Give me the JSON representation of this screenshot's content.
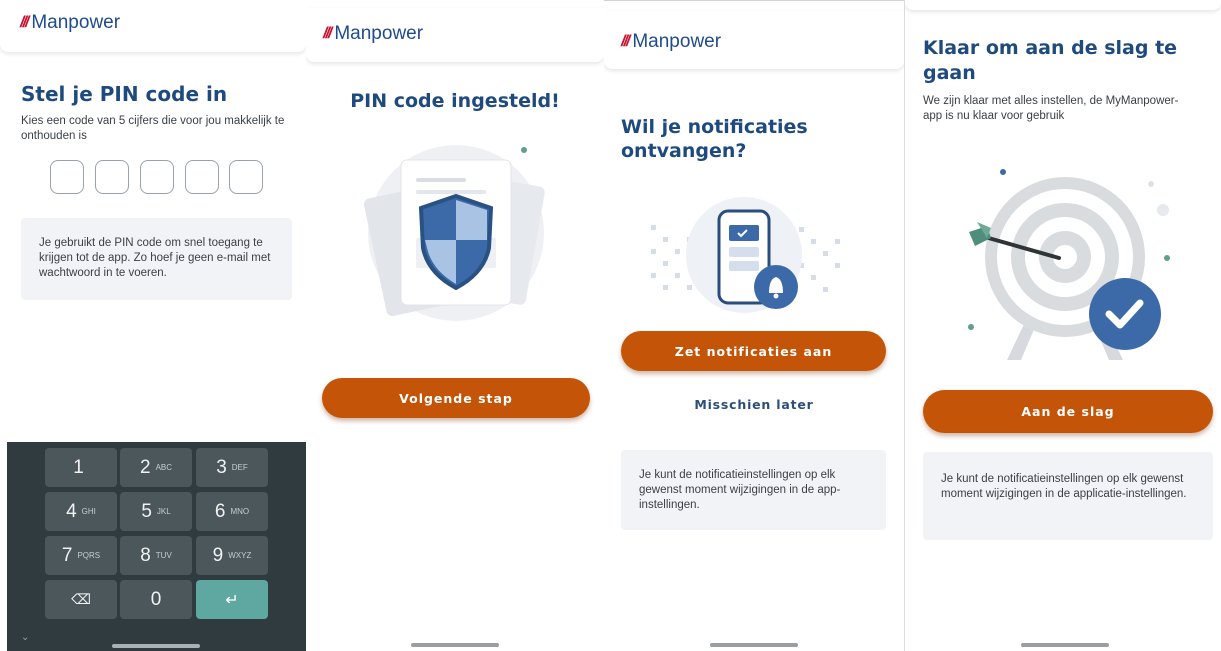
{
  "brand": {
    "mark": "///",
    "name": "Manpower"
  },
  "screen1": {
    "title": "Stel je PIN code in",
    "subtitle": "Kies een code van 5 cijfers die voor jou makkelijk te onthouden is",
    "info": "Je gebruikt de PIN code om snel toegang te krijgen tot de app. Zo hoef je geen e-mail met wachtwoord in te voeren.",
    "keypad": {
      "keys": [
        {
          "num": "1",
          "sub": ""
        },
        {
          "num": "2",
          "sub": "ABC"
        },
        {
          "num": "3",
          "sub": "DEF"
        },
        {
          "num": "4",
          "sub": "GHI"
        },
        {
          "num": "5",
          "sub": "JKL"
        },
        {
          "num": "6",
          "sub": "MNO"
        },
        {
          "num": "7",
          "sub": "PQRS"
        },
        {
          "num": "8",
          "sub": "TUV"
        },
        {
          "num": "9",
          "sub": "WXYZ"
        },
        {
          "num": "⌫",
          "sub": ""
        },
        {
          "num": "0",
          "sub": ""
        },
        {
          "num": "↵",
          "sub": ""
        }
      ],
      "collapse": "⌄"
    }
  },
  "screen2": {
    "title": "PIN code ingesteld!",
    "button": "Volgende stap"
  },
  "screen3": {
    "title": "Wil je notificaties ontvangen?",
    "button": "Zet notificaties aan",
    "secondary": "Misschien later",
    "info": "Je kunt de notificatieinstellingen op elk gewenst moment wijzigingen in de app-instellingen."
  },
  "screen4": {
    "title": "Klaar om aan de slag te gaan",
    "subtitle": "We zijn klaar met alles instellen, de MyManpower-app is nu klaar voor gebruik",
    "button": "Aan de slag",
    "info": "Je kunt de notificatieinstellingen op elk gewenst moment wijzigingen in de applicatie-instellingen."
  },
  "colors": {
    "primary": "#c45508",
    "navy": "#1e4a7f",
    "brandRed": "#c8102e",
    "brandBlue": "#1f4b8e",
    "teal": "#5fa7a1"
  }
}
